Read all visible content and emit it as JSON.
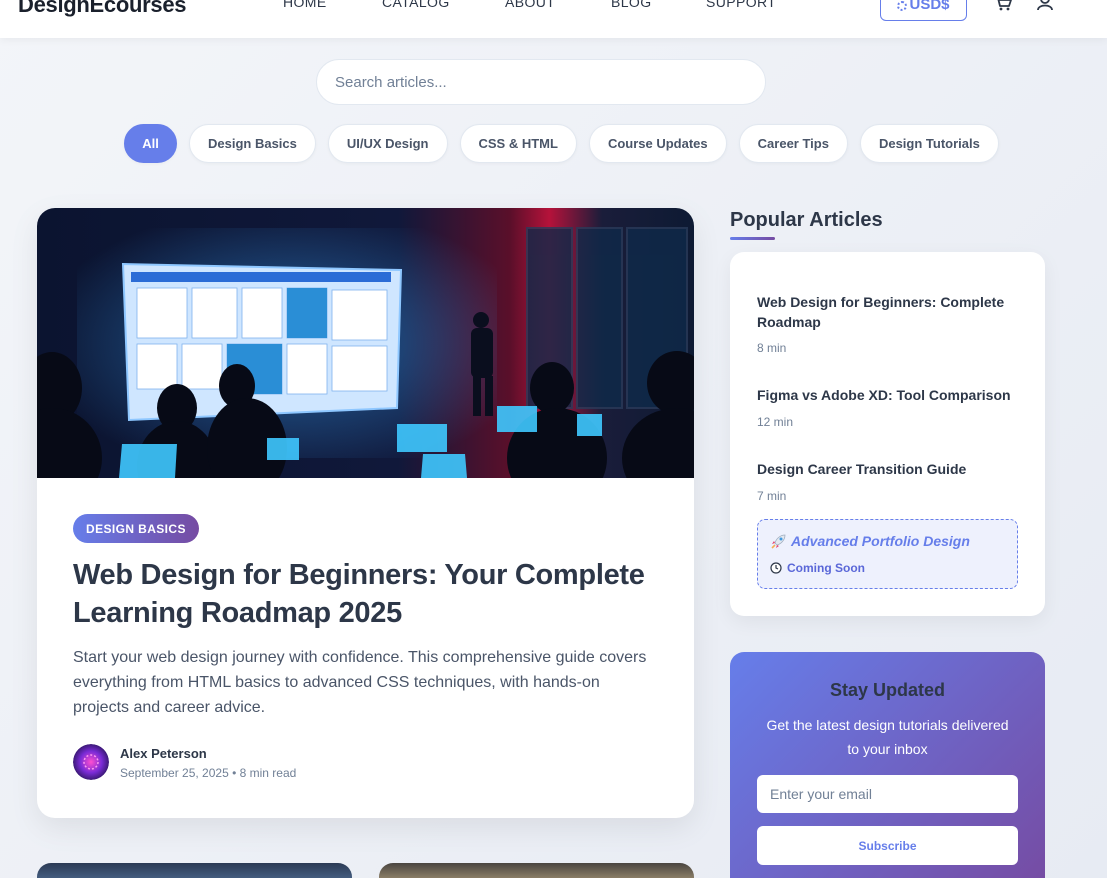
{
  "header": {
    "logo": "DesignEcourses",
    "nav": [
      "HOME",
      "CATALOG",
      "ABOUT",
      "BLOG",
      "SUPPORT"
    ],
    "currency": "USD$",
    "icons": [
      "cart-icon",
      "user-icon"
    ]
  },
  "search": {
    "placeholder": "Search articles..."
  },
  "filters": [
    "All",
    "Design Basics",
    "UI/UX Design",
    "CSS & HTML",
    "Course Updates",
    "Career Tips",
    "Design Tutorials"
  ],
  "featured": {
    "badge": "DESIGN BASICS",
    "title": "Web Design for Beginners: Your Complete Learning Roadmap 2025",
    "excerpt": "Start your web design journey with confidence. This comprehensive guide covers everything from HTML basics to advanced CSS techniques, with hands-on projects and career advice.",
    "author": "Alex Peterson",
    "meta": "September 25, 2025 • 8 min read"
  },
  "popular": {
    "heading": "Popular Articles",
    "items": [
      {
        "title": "Web Design for Beginners: Complete Roadmap",
        "time": "8 min"
      },
      {
        "title": "Figma vs Adobe XD: Tool Comparison",
        "time": "12 min"
      },
      {
        "title": "Design Career Transition Guide",
        "time": "7 min"
      }
    ],
    "coming": {
      "title": "Advanced Portfolio Design",
      "status": "Coming Soon"
    }
  },
  "newsletter": {
    "title": "Stay Updated",
    "subtitle": "Get the latest design tutorials delivered to your inbox",
    "placeholder": "Enter your email",
    "button": "Subscribe"
  },
  "colors": {
    "accent": "#667eea",
    "accent_dark": "#764ba2",
    "text": "#2d3748",
    "muted": "#718096"
  }
}
